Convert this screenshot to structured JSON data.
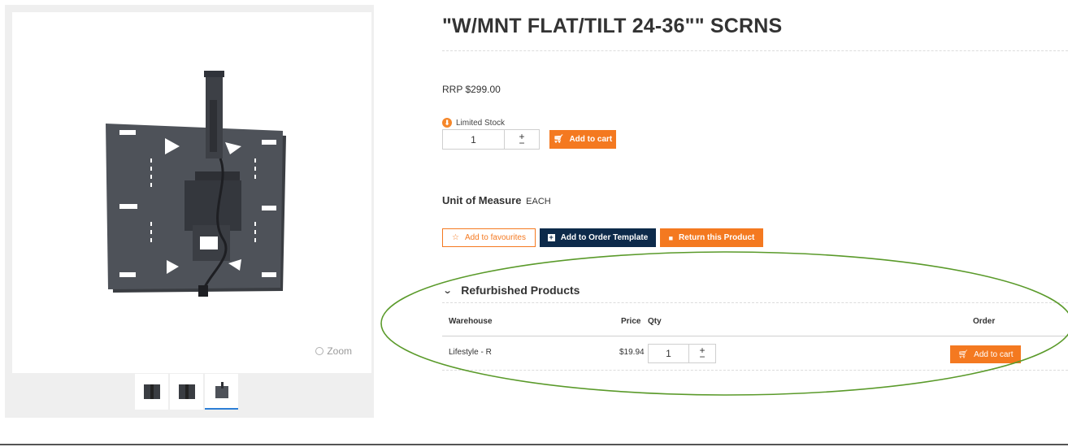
{
  "product": {
    "title": "\"W/MNT FLAT/TILT 24-36\"\" SCRNS",
    "rrp": "RRP $299.00",
    "stock_status": "Limited Stock",
    "quantity": "1",
    "add_to_cart": "Add to cart",
    "uom_label": "Unit of Measure",
    "uom_value": "EACH"
  },
  "gallery": {
    "zoom_label": "Zoom",
    "thumbnail_count": 3,
    "active_thumbnail": 3
  },
  "actions": {
    "favourites": "Add to favourites",
    "order_template": "Add to Order Template",
    "return_product": "Return this Product"
  },
  "refurbished": {
    "heading": "Refurbished Products",
    "columns": [
      "Warehouse",
      "Price",
      "Qty",
      "Order"
    ],
    "rows": [
      {
        "warehouse": "Lifestyle - R",
        "price": "$19.94",
        "qty": "1",
        "order_label": "Add to cart"
      }
    ]
  },
  "icons": {
    "stock": "download-circle-icon",
    "cart": "cart-icon",
    "star": "star-icon",
    "plus_square": "plus-square-icon",
    "truck": "truck-icon",
    "chevron": "chevron-down-icon",
    "zoom": "zoom-icon"
  },
  "colors": {
    "accent_orange": "#f47920",
    "navy": "#0d2a4a",
    "annotation_green": "#5a9a2a",
    "thumb_active": "#2d7fd6"
  }
}
